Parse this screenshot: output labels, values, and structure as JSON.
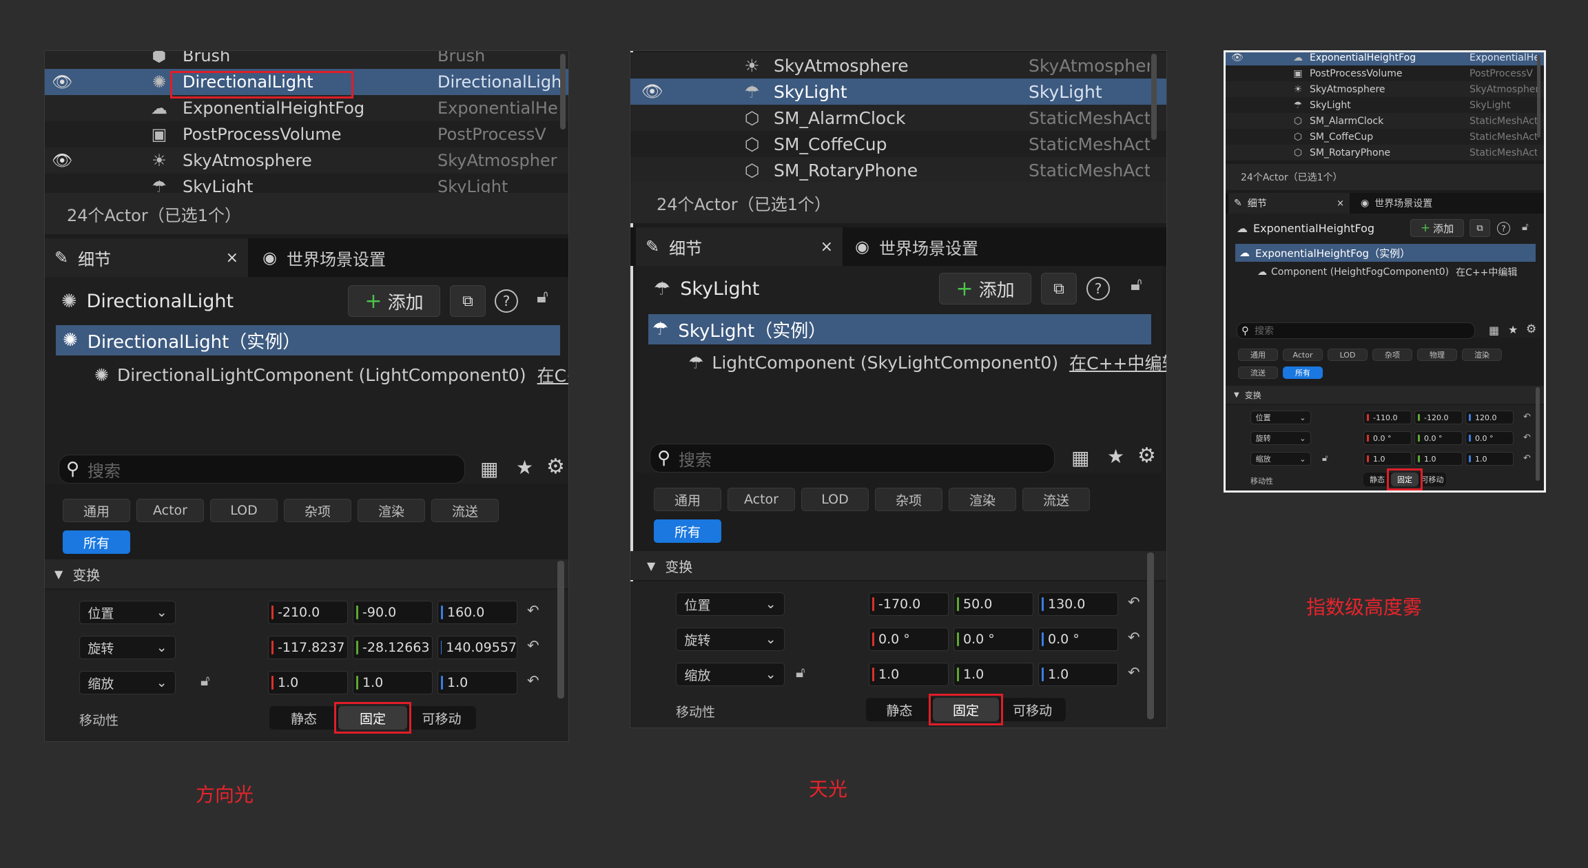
{
  "panel1": {
    "outliner": [
      {
        "name": "Brush",
        "type": "Brush",
        "icon": "brush-icon",
        "visible": false
      },
      {
        "name": "DirectionalLight",
        "type": "DirectionalLigh",
        "icon": "sun-icon",
        "visible": true,
        "selected": true
      },
      {
        "name": "ExponentialHeightFog",
        "type": "ExponentialHe",
        "icon": "fog-icon",
        "visible": false
      },
      {
        "name": "PostProcessVolume",
        "type": "PostProcessV",
        "icon": "volume-icon",
        "visible": false
      },
      {
        "name": "SkyAtmosphere",
        "type": "SkyAtmospher",
        "icon": "sky-atmosphere-icon",
        "visible": true
      },
      {
        "name": "SkyLight",
        "type": "SkyLight",
        "icon": "skylight-icon",
        "visible": false
      }
    ],
    "actor_count": "24个Actor（已选1个）",
    "tab_details": "细节",
    "tab_world": "世界场景设置",
    "actor_name": "DirectionalLight",
    "add_label": "添加",
    "instance_label": "DirectionalLight（实例）",
    "component_label": "DirectionalLightComponent (LightComponent0)",
    "edit_cpp": "在C++",
    "search_placeholder": "搜索",
    "filters": [
      "通用",
      "Actor",
      "LOD",
      "杂项",
      "渲染",
      "流送"
    ],
    "filter_all": "所有",
    "section": "变换",
    "location_label": "位置",
    "rotation_label": "旋转",
    "scale_label": "缩放",
    "mobility_label": "移动性",
    "location": [
      "-210.0",
      "-90.0",
      "160.0"
    ],
    "rotation": [
      "-117.8237",
      "-28.12663",
      "140.09557"
    ],
    "scale": [
      "1.0",
      "1.0",
      "1.0"
    ],
    "mobility": [
      "静态",
      "固定",
      "可移动"
    ],
    "caption": "方向光"
  },
  "panel2": {
    "outliner": [
      {
        "name": "SkyAtmosphere",
        "type": "SkyAtmospher",
        "icon": "sky-atmosphere-icon",
        "visible": false
      },
      {
        "name": "SkyLight",
        "type": "SkyLight",
        "icon": "skylight-icon",
        "visible": true,
        "selected": true
      },
      {
        "name": "SM_AlarmClock",
        "type": "StaticMeshAct",
        "icon": "static-mesh-icon",
        "visible": false
      },
      {
        "name": "SM_CoffeCup",
        "type": "StaticMeshAct",
        "icon": "static-mesh-icon",
        "visible": false
      },
      {
        "name": "SM_RotaryPhone",
        "type": "StaticMeshAct",
        "icon": "static-mesh-icon",
        "visible": false
      }
    ],
    "actor_count": "24个Actor（已选1个）",
    "tab_details": "细节",
    "tab_world": "世界场景设置",
    "actor_name": "SkyLight",
    "add_label": "添加",
    "instance_label": "SkyLight（实例）",
    "component_label": "LightComponent (SkyLightComponent0)",
    "edit_cpp": "在C++中编辑",
    "search_placeholder": "搜索",
    "filters": [
      "通用",
      "Actor",
      "LOD",
      "杂项",
      "渲染",
      "流送"
    ],
    "filter_all": "所有",
    "section": "变换",
    "location_label": "位置",
    "rotation_label": "旋转",
    "scale_label": "缩放",
    "mobility_label": "移动性",
    "location": [
      "-170.0",
      "50.0",
      "130.0"
    ],
    "rotation": [
      "0.0 °",
      "0.0 °",
      "0.0 °"
    ],
    "scale": [
      "1.0",
      "1.0",
      "1.0"
    ],
    "mobility": [
      "静态",
      "固定",
      "可移动"
    ],
    "caption": "天光"
  },
  "panel3": {
    "outliner": [
      {
        "name": "ExponentialHeightFog",
        "type": "ExponentialHe",
        "icon": "fog-icon",
        "visible": true,
        "selected": true
      },
      {
        "name": "PostProcessVolume",
        "type": "PostProcessV",
        "icon": "volume-icon",
        "visible": false
      },
      {
        "name": "SkyAtmosphere",
        "type": "SkyAtmospher",
        "icon": "sky-atmosphere-icon",
        "visible": false
      },
      {
        "name": "SkyLight",
        "type": "SkyLight",
        "icon": "skylight-icon",
        "visible": false
      },
      {
        "name": "SM_AlarmClock",
        "type": "StaticMeshAct",
        "icon": "static-mesh-icon",
        "visible": false
      },
      {
        "name": "SM_CoffeCup",
        "type": "StaticMeshAct",
        "icon": "static-mesh-icon",
        "visible": false
      },
      {
        "name": "SM_RotaryPhone",
        "type": "StaticMeshAct",
        "icon": "static-mesh-icon",
        "visible": false
      }
    ],
    "actor_count": "24个Actor（已选1个）",
    "tab_details": "细节",
    "tab_world": "世界场景设置",
    "actor_name": "ExponentialHeightFog",
    "add_label": "添加",
    "instance_label": "ExponentialHeightFog（实例）",
    "component_label": "Component (HeightFogComponent0)",
    "edit_cpp": "在C++中编辑",
    "search_placeholder": "搜索",
    "filters": [
      "通用",
      "Actor",
      "LOD",
      "杂项",
      "物理",
      "渲染"
    ],
    "filters2": [
      "流送"
    ],
    "filter_all": "所有",
    "section": "变换",
    "location_label": "位置",
    "rotation_label": "旋转",
    "scale_label": "缩放",
    "mobility_label": "移动性",
    "location": [
      "-110.0",
      "-120.0",
      "120.0"
    ],
    "rotation": [
      "0.0 °",
      "0.0 °",
      "0.0 °"
    ],
    "scale": [
      "1.0",
      "1.0",
      "1.0"
    ],
    "mobility": [
      "静态",
      "固定",
      "可移动"
    ],
    "caption": "指数级高度雾"
  },
  "colors": {
    "x": "#d8332a",
    "y": "#5ea832",
    "z": "#3b7de0",
    "accent": "#1a78e0",
    "selection": "#3d5a80",
    "highlight": "#e01e28"
  }
}
